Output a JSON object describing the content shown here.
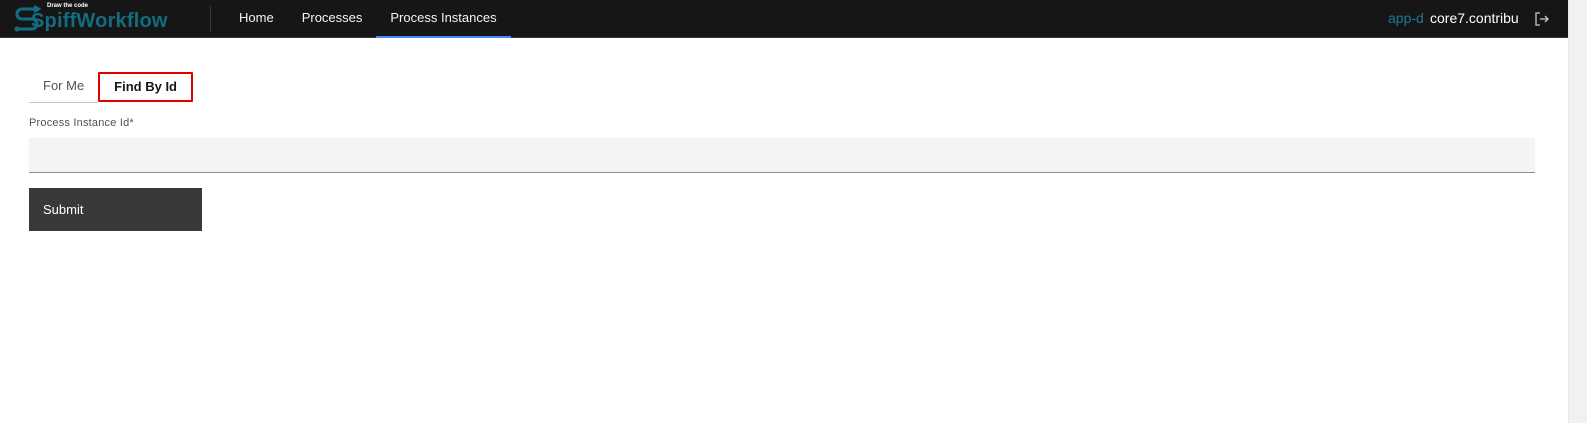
{
  "header": {
    "logo": {
      "tagline": "Draw the code",
      "name": "SpiffWorkflow",
      "icon": "spiff-s-arrow-icon"
    },
    "nav_items": [
      {
        "label": "Home",
        "active": false
      },
      {
        "label": "Processes",
        "active": false
      },
      {
        "label": "Process Instances",
        "active": true
      }
    ],
    "user": {
      "prefix": "app-d",
      "name": "core7.contribu"
    },
    "logout_icon": "logout-icon"
  },
  "tabs": [
    {
      "label": "For Me",
      "selected": false
    },
    {
      "label": "Find By Id",
      "selected": true
    }
  ],
  "form": {
    "field_label": "Process Instance Id*",
    "field_value": "",
    "field_placeholder": "",
    "submit_label": "Submit"
  },
  "colors": {
    "header_bg": "#161616",
    "brand": "#126d82",
    "nav_active_underline": "#4589ff",
    "highlight_box": "#e50000",
    "button_bg": "#393939",
    "input_bg": "#f4f4f4"
  }
}
